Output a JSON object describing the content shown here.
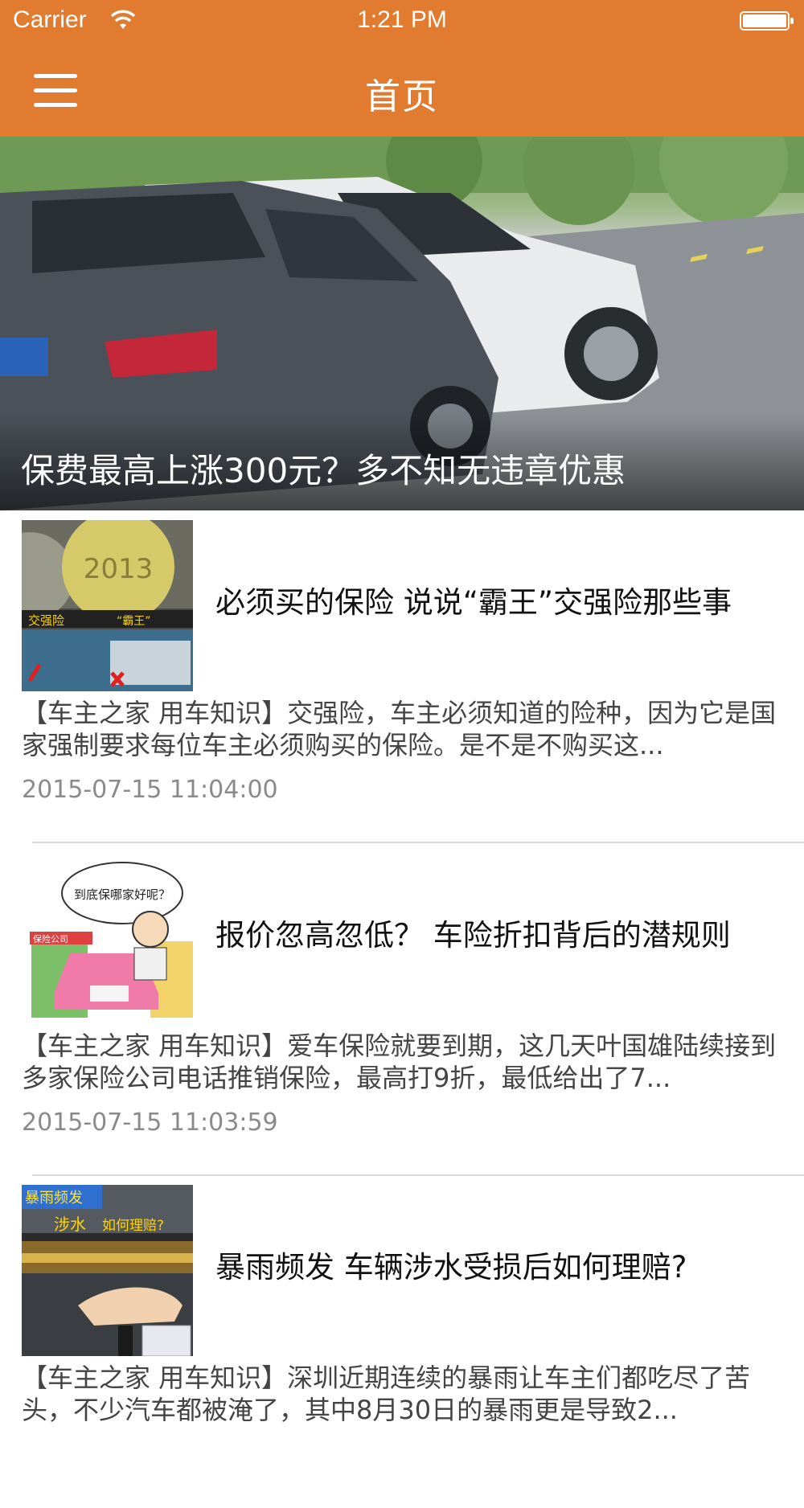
{
  "status_bar": {
    "carrier": "Carrier",
    "time": "1:21 PM"
  },
  "nav": {
    "title": "首页",
    "menu_icon": "hamburger-menu-icon"
  },
  "banner": {
    "caption": "保费最高上涨300元？多不知无违章优惠",
    "thumb_text": "2013"
  },
  "articles": [
    {
      "title": "必须买的保险 说说“霸王”交强险那些事",
      "summary": "【车主之家 用车知识】交强险，车主必须知道的险种，因为它是国家强制要求每位车主必须购买的保险。是不是不购买这...",
      "time": "2015-07-15 11:04:00",
      "thumb_labels": [
        "2013",
        "交强险",
        "“霸王”"
      ]
    },
    {
      "title": "报价忽高忽低？ 车险折扣背后的潜规则",
      "summary": "【车主之家 用车知识】爱车保险就要到期，这几天叶国雄陆续接到多家保险公司电话推销保险，最高打9折，最低给出了7...",
      "time": "2015-07-15 11:03:59",
      "thumb_labels": [
        "到底保哪家好呢？",
        "保险公司"
      ]
    },
    {
      "title": "暴雨频发 车辆涉水受损后如何理赔?",
      "summary": "【车主之家 用车知识】深圳近期连续的暴雨让车主们都吃尽了苦头，不少汽车都被淹了，其中8月30日的暴雨更是导致2...",
      "time": "",
      "thumb_labels": [
        "暴雨频发",
        "涉水",
        "如何理赔?"
      ]
    }
  ],
  "colors": {
    "accent": "#e07b30",
    "divider": "#d9d9d9",
    "time_text": "#8a8a8a"
  }
}
